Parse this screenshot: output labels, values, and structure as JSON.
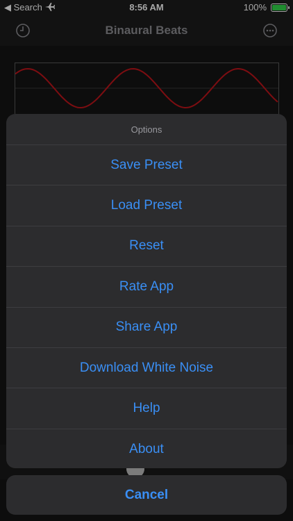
{
  "status_bar": {
    "back_label": "◀ Search",
    "time": "8:56 AM",
    "battery_percent": "100%",
    "battery_level": 1.0
  },
  "nav": {
    "title": "Binaural Beats",
    "left_icon": "clock-icon",
    "right_icon": "more-icon"
  },
  "colors": {
    "accent": "#3a8ff5",
    "wave": "#c0141b",
    "battery": "#32d74b"
  },
  "action_sheet": {
    "title": "Options",
    "items": [
      {
        "label": "Save Preset"
      },
      {
        "label": "Load Preset"
      },
      {
        "label": "Reset"
      },
      {
        "label": "Rate App"
      },
      {
        "label": "Share App"
      },
      {
        "label": "Download White Noise"
      },
      {
        "label": "Help"
      },
      {
        "label": "About"
      }
    ],
    "cancel_label": "Cancel"
  }
}
